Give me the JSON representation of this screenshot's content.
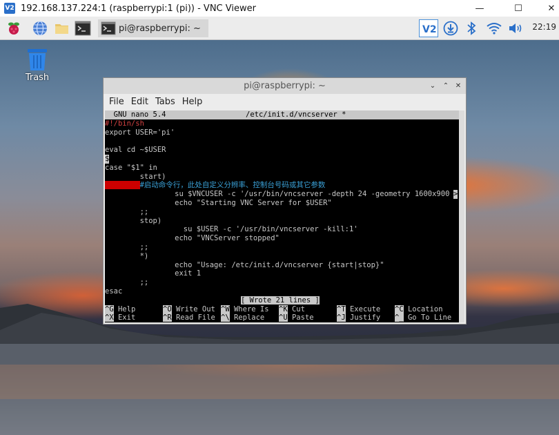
{
  "vnc_window": {
    "title": "192.168.137.224:1 (raspberrypi:1 (pi)) - VNC Viewer",
    "logo": "V2",
    "minimize_label": "—",
    "maximize_label": "☐",
    "close_label": "✕"
  },
  "panel": {
    "task_label": "pi@raspberrypi: ~",
    "clock": "22:19",
    "icons": [
      "raspberry-menu-icon",
      "globe-browser-icon",
      "folder-icon",
      "terminal-icon",
      "vnc-tray-icon",
      "download-icon",
      "bluetooth-icon",
      "wifi-icon",
      "volume-icon"
    ]
  },
  "desktop": {
    "trash_label": "Trash"
  },
  "terminal_window": {
    "title": "pi@raspberrypi: ~",
    "menu": [
      "File",
      "Edit",
      "Tabs",
      "Help"
    ]
  },
  "nano": {
    "header_left": "  GNU nano 5.4",
    "header_file": "/etc/init.d/vncserver *",
    "lines": [
      {
        "text": "#!/bin/sh",
        "style": "red"
      },
      {
        "text": "export USER='pi'",
        "style": "normal"
      },
      {
        "text": "",
        "style": "normal"
      },
      {
        "text": "eval cd ~$USER",
        "style": "normal"
      },
      {
        "text": "$",
        "style": "cursor"
      },
      {
        "text": "case \"$1\" in",
        "style": "normal"
      },
      {
        "text": "        start)",
        "style": "normal"
      },
      {
        "text": "                #启动命令行，此处自定义分辨率、控制台号码或其它参数",
        "style": "comment_redblock"
      },
      {
        "text": "                su $VNCUSER -c '/usr/bin/vncserver -depth 24 -geometry 1600x900",
        "style": "normal_overflow"
      },
      {
        "text": "                echo \"Starting VNC Server for $USER\"",
        "style": "normal"
      },
      {
        "text": "        ;;",
        "style": "normal"
      },
      {
        "text": "        stop)",
        "style": "normal"
      },
      {
        "text": "                  su $USER -c '/usr/bin/vncserver -kill:1'",
        "style": "normal"
      },
      {
        "text": "                echo \"VNCServer stopped\"",
        "style": "normal"
      },
      {
        "text": "        ;;",
        "style": "normal"
      },
      {
        "text": "        *)",
        "style": "normal"
      },
      {
        "text": "                echo \"Usage: /etc/init.d/vncserver {start|stop}\"",
        "style": "normal"
      },
      {
        "text": "                exit 1",
        "style": "normal"
      },
      {
        "text": "        ;;",
        "style": "normal"
      },
      {
        "text": "esac",
        "style": "normal"
      }
    ],
    "status": "[ Wrote 21 lines ]",
    "shortcuts_row1": [
      {
        "key": "^G",
        "label": "Help"
      },
      {
        "key": "^O",
        "label": "Write Out"
      },
      {
        "key": "^W",
        "label": "Where Is"
      },
      {
        "key": "^K",
        "label": "Cut"
      },
      {
        "key": "^T",
        "label": "Execute"
      },
      {
        "key": "^C",
        "label": "Location"
      }
    ],
    "shortcuts_row2": [
      {
        "key": "^X",
        "label": "Exit"
      },
      {
        "key": "^R",
        "label": "Read File"
      },
      {
        "key": "^\\",
        "label": "Replace"
      },
      {
        "key": "^U",
        "label": "Paste"
      },
      {
        "key": "^J",
        "label": "Justify"
      },
      {
        "key": "^_",
        "label": "Go To Line"
      }
    ]
  }
}
